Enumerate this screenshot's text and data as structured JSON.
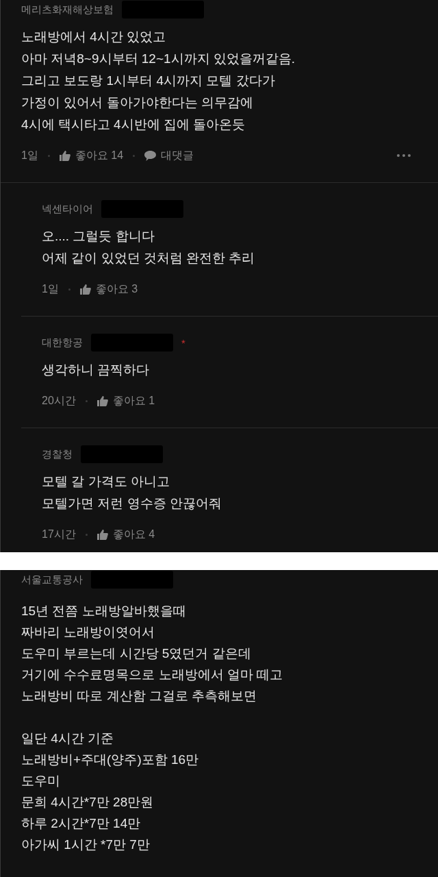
{
  "panels": [
    {
      "comments": [
        {
          "kind": "comment",
          "author": "메리츠화재해상보험",
          "body": "노래방에서 4시간 있었고\n아마 저녁8~9시부터 12~1시까지 있었을꺼같음.\n그리고 보도랑 1시부터 4시까지 모텔 갔다가\n가정이 있어서 돌아가야한다는 의무감에\n4시에 택시타고 4시반에 집에 돌아온듯",
          "time": "1일",
          "likes": "좋아요 14",
          "reply_label": "대댓글"
        },
        {
          "kind": "reply",
          "author": "넥센타이어",
          "body": "오.... 그럴듯 합니다\n어제 같이 있었던 것처럼 완전한 추리",
          "time": "1일",
          "likes": "좋아요 3"
        },
        {
          "kind": "reply",
          "author": "대한항공",
          "badge": "*",
          "body": "생각하니 끔찍하다",
          "time": "20시간",
          "likes": "좋아요 1"
        },
        {
          "kind": "reply",
          "author": "경찰청",
          "body": "모텔 갈 가격도 아니고\n모텔가면 저런 영수증 안끊어줘",
          "time": "17시간",
          "likes": "좋아요 4"
        }
      ]
    },
    {
      "comments": [
        {
          "kind": "comment",
          "author": "서울교통공사",
          "body": "15년 전쯤 노래방알바했을때\n짜바리 노래방이엿어서\n도우미 부르는데 시간당 5였던거 같은데\n거기에 수수료명목으로 노래방에서 얼마 떼고\n노래방비 따로 계산함 그걸로 추측해보면\n\n일단 4시간 기준\n노래방비+주대(양주)포함 16만\n도우미\n문희 4시간*7만 28만원\n하루 2시간*7만 14만\n아가씨 1시간 *7만 7만"
        }
      ]
    }
  ]
}
